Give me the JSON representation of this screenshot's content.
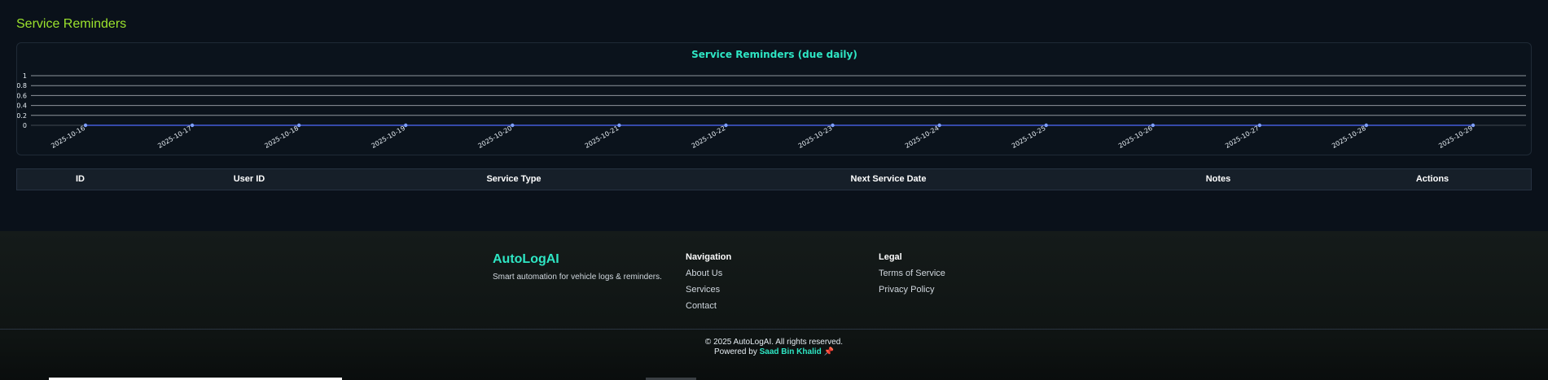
{
  "page": {
    "title": "Service Reminders"
  },
  "chart_data": {
    "type": "line",
    "title": "Service Reminders (due daily)",
    "xlabel": "",
    "ylabel": "",
    "categories": [
      "2025-10-16",
      "2025-10-17",
      "2025-10-18",
      "2025-10-19",
      "2025-10-20",
      "2025-10-21",
      "2025-10-22",
      "2025-10-23",
      "2025-10-24",
      "2025-10-25",
      "2025-10-26",
      "2025-10-27",
      "2025-10-28",
      "2025-10-29"
    ],
    "values": [
      0,
      0,
      0,
      0,
      0,
      0,
      0,
      0,
      0,
      0,
      0,
      0,
      0,
      0
    ],
    "ylim": [
      0,
      1
    ],
    "yticks": [
      "0",
      "0.2",
      "0.4",
      "0.6",
      "0.8",
      "1"
    ],
    "grid": true,
    "colors": {
      "line": "#4f6bff",
      "grid": "#e6edf3",
      "title": "#2ee6c4"
    }
  },
  "table": {
    "headers": [
      "ID",
      "User ID",
      "Service Type",
      "Next Service Date",
      "Notes",
      "Actions"
    ]
  },
  "footer": {
    "brand": "AutoLogAI",
    "tagline": "Smart automation for vehicle logs & reminders.",
    "navigation": {
      "title": "Navigation",
      "links": [
        "About Us",
        "Services",
        "Contact"
      ]
    },
    "legal": {
      "title": "Legal",
      "links": [
        "Terms of Service",
        "Privacy Policy"
      ]
    },
    "copyright": "© 2025 AutoLogAI. All rights reserved.",
    "powered_prefix": "Powered by ",
    "author": "Saad Bin Khalid",
    "pin_icon": "pin-icon"
  }
}
